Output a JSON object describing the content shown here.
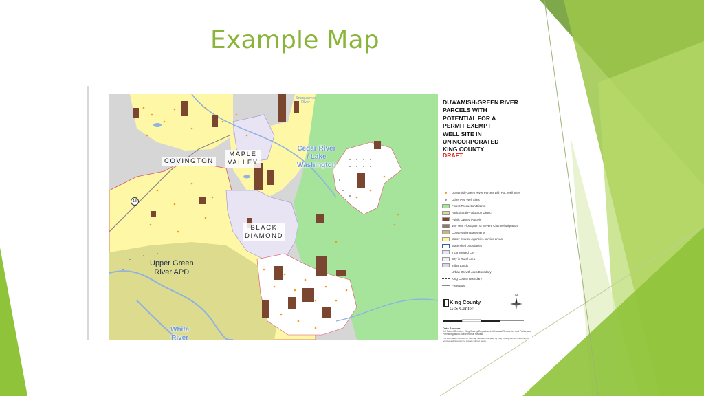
{
  "slide": {
    "title": "Example Map"
  },
  "map": {
    "legend_title": "DUWAMISH-GREEN RIVER\nPARCELS WITH\nPOTENTIAL FOR A\nPERMIT EXEMPT\nWELL SITE IN\nUNINCORPORATED\nKING COUNTY",
    "legend_status": "DRAFT",
    "legend_items": [
      {
        "label": "Duwamish-Green River Parcels with Pot. Well Sites",
        "symbol": "dot",
        "color": "#f29a1f"
      },
      {
        "label": "Other Pot. Well Sites",
        "symbol": "dot",
        "color": "#9a9a9a"
      },
      {
        "label": "Forest Production District",
        "symbol": "box",
        "color": "#a6e39b"
      },
      {
        "label": "Agricultural Production District",
        "symbol": "box",
        "color": "#dedc8c"
      },
      {
        "label": "Public Owned Parcels",
        "symbol": "box",
        "color": "#7a4630"
      },
      {
        "label": "100 Year Floodplain or Severe Channel Migration",
        "symbol": "box",
        "color": "#8e7a6a"
      },
      {
        "label": "Conservation Easements",
        "symbol": "box",
        "color": "#c9b48a"
      },
      {
        "label": "Water Service Agencies service areas",
        "symbol": "box",
        "color": "#fdf79a"
      },
      {
        "label": "Watershed boundaries",
        "symbol": "outline",
        "color": "#3b5fb0"
      },
      {
        "label": "Incorporated City",
        "symbol": "box",
        "color": "#e8e4f4"
      },
      {
        "label": "City in Rural Area",
        "symbol": "box",
        "color": "#f1eef8"
      },
      {
        "label": "Tribal Lands",
        "symbol": "box",
        "color": "#d7d7ef"
      },
      {
        "label": "Urban Growth Area Boundary",
        "symbol": "line",
        "color": "#d9536a"
      },
      {
        "label": "King County Boundary",
        "symbol": "dash",
        "color": "#444444"
      },
      {
        "label": "Freeways",
        "symbol": "line",
        "color": "#888888"
      }
    ],
    "place_labels": {
      "covington": "COVINGTON",
      "maple_valley": "MAPLE\nVALLEY",
      "black_diamond": "BLACK\nDIAMOND"
    },
    "water_labels": {
      "cedar_river": "Cedar River\n/ Lake\nWashington",
      "white_river": "White\nRiver",
      "snoqualmie": "Snoqualmie\nRiver"
    },
    "region_labels": {
      "upper_green": "Upper Green\nRiver APD"
    },
    "highway_shield": "18",
    "agency": {
      "name": "King County",
      "unit": "GIS Center"
    },
    "north_label": "N",
    "data_sources_title": "Data Sources:",
    "data_sources_text": "KC Parcel Services; King County Department of Natural Resources and Parks, and Permitting and Environmental Review",
    "disclaimer": "The information included on this map has been compiled by King County staff from a variety of sources and is subject to change without notice."
  },
  "colors": {
    "title_green": "#8ab43a",
    "urban_gray": "#d6d6d6",
    "rural_yellow": "#fdf7a6",
    "apd_olive": "#dcdb8e",
    "forest_green": "#a6e39b",
    "public_brown": "#7a4630",
    "water_blue": "#8fb2e3",
    "well_orange": "#f29a1f",
    "draft_red": "#e0201b"
  }
}
